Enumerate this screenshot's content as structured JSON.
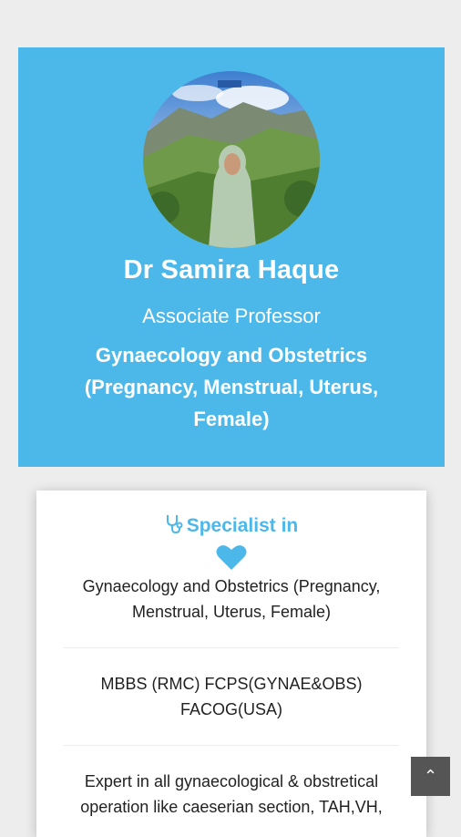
{
  "profile": {
    "name": "Dr Samira Haque",
    "title": "Associate Professor",
    "department": "Gynaecology and Obstetrics (Pregnancy, Menstrual, Uterus, Female)"
  },
  "specialist": {
    "heading": "Specialist in",
    "heading_icon": "stethoscope-icon",
    "heart_icon": "heart-icon",
    "items": [
      "Gynaecology and Obstetrics (Pregnancy, Menstrual, Uterus, Female)",
      "MBBS (RMC) FCPS(GYNAE&OBS) FACOG(USA)",
      "Expert in all gynaecological & obstretical operation like caeserian section, TAH,VH,"
    ]
  },
  "scroll_top": {
    "icon": "chevron-up-icon",
    "glyph": "⌃"
  },
  "colors": {
    "brand": "#4cb8ea",
    "background": "#ededed",
    "scroll_button": "#555555"
  }
}
